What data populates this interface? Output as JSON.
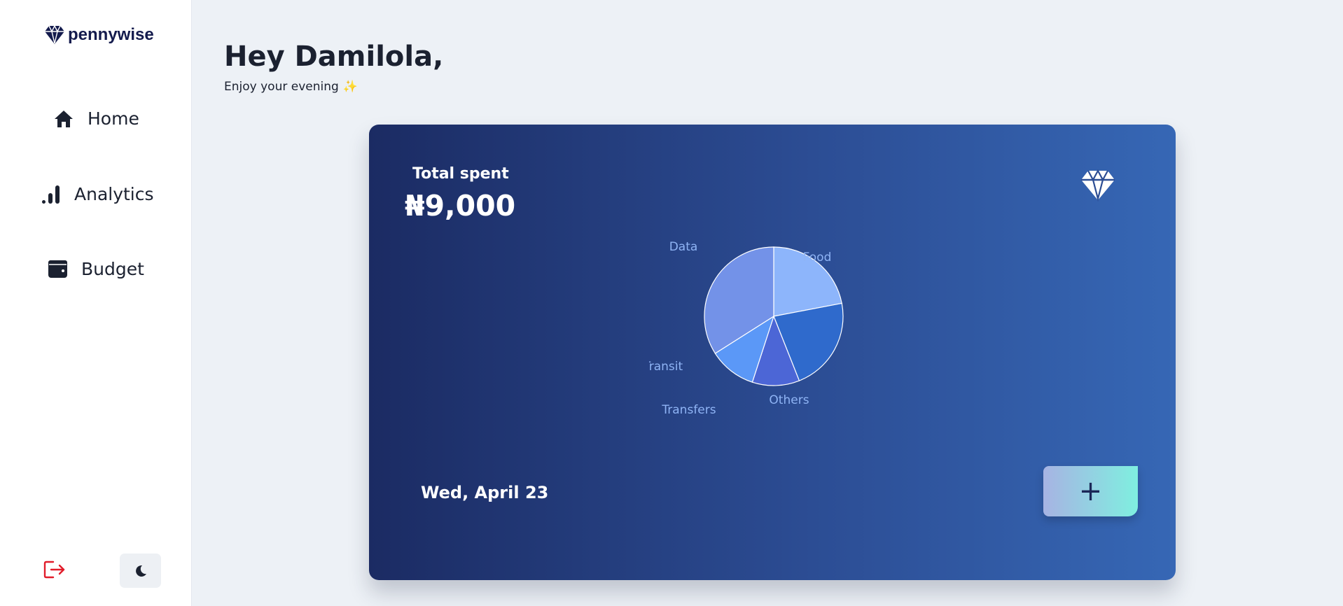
{
  "app": {
    "name": "pennywise"
  },
  "sidebar": {
    "items": [
      {
        "label": "Home",
        "icon": "home-icon"
      },
      {
        "label": "Analytics",
        "icon": "bar-chart-icon"
      },
      {
        "label": "Budget",
        "icon": "wallet-icon"
      }
    ],
    "logout_icon": "logout-icon",
    "theme_icon": "moon-icon",
    "colors": {
      "logout": "#e11d2b"
    }
  },
  "header": {
    "greeting": "Hey Damilola,",
    "subtitle": "Enjoy your evening",
    "subtitle_emoji": "✨"
  },
  "card": {
    "total_label": "Total spent",
    "total_value": "₦9,000",
    "date": "Wed, April 23",
    "add_label": "+",
    "gradient": [
      "#1b2b63",
      "#3667b5"
    ]
  },
  "chart_data": {
    "type": "pie",
    "categories": [
      "Food",
      "Others",
      "Transfers",
      "Transit",
      "Data"
    ],
    "values": [
      22,
      22,
      11,
      11,
      34
    ],
    "colors": [
      "#8db5fb",
      "#2f6acc",
      "#4c66d6",
      "#5b98f7",
      "#7392e8"
    ],
    "label_color": "#8fb4f5"
  }
}
